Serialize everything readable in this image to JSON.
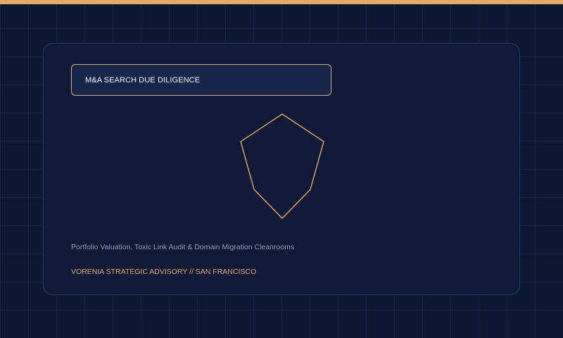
{
  "brand": {
    "accent_color": "#e0a86a",
    "background_color": "#0c1830",
    "card_color": "#0e1a36"
  },
  "card": {
    "title": "M&A SEARCH DUE DILIGENCE",
    "emblem_icon": "pentagon-shield-outline-icon",
    "subtitle": "Portfolio Valuation, Toxic Link Audit & Domain Migration Cleanrooms",
    "footer": "VORENIA STRATEGIC ADVISORY // SAN FRANCISCO"
  }
}
